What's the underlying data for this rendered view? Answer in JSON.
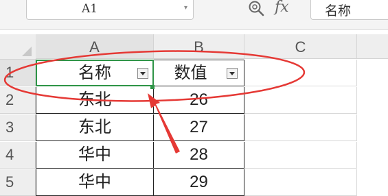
{
  "formula_bar": {
    "name_box": "A1",
    "fx_label": "fx",
    "formula_value": "名称"
  },
  "columns": [
    "A",
    "B",
    "C"
  ],
  "rows": [
    "1",
    "2",
    "3",
    "4",
    "5"
  ],
  "table": {
    "headers": [
      "名称",
      "数值"
    ],
    "records": [
      [
        "东北",
        "26"
      ],
      [
        "东北",
        "27"
      ],
      [
        "华中",
        "28"
      ],
      [
        "华中",
        "29"
      ]
    ]
  },
  "colors": {
    "selection": "#2e9447",
    "annotation": "#e53935"
  },
  "icons": {
    "zoom": "magnifier-zoom-icon",
    "filter": "filter-dropdown-icon",
    "name_box_dropdown": "chevron-down-icon"
  }
}
